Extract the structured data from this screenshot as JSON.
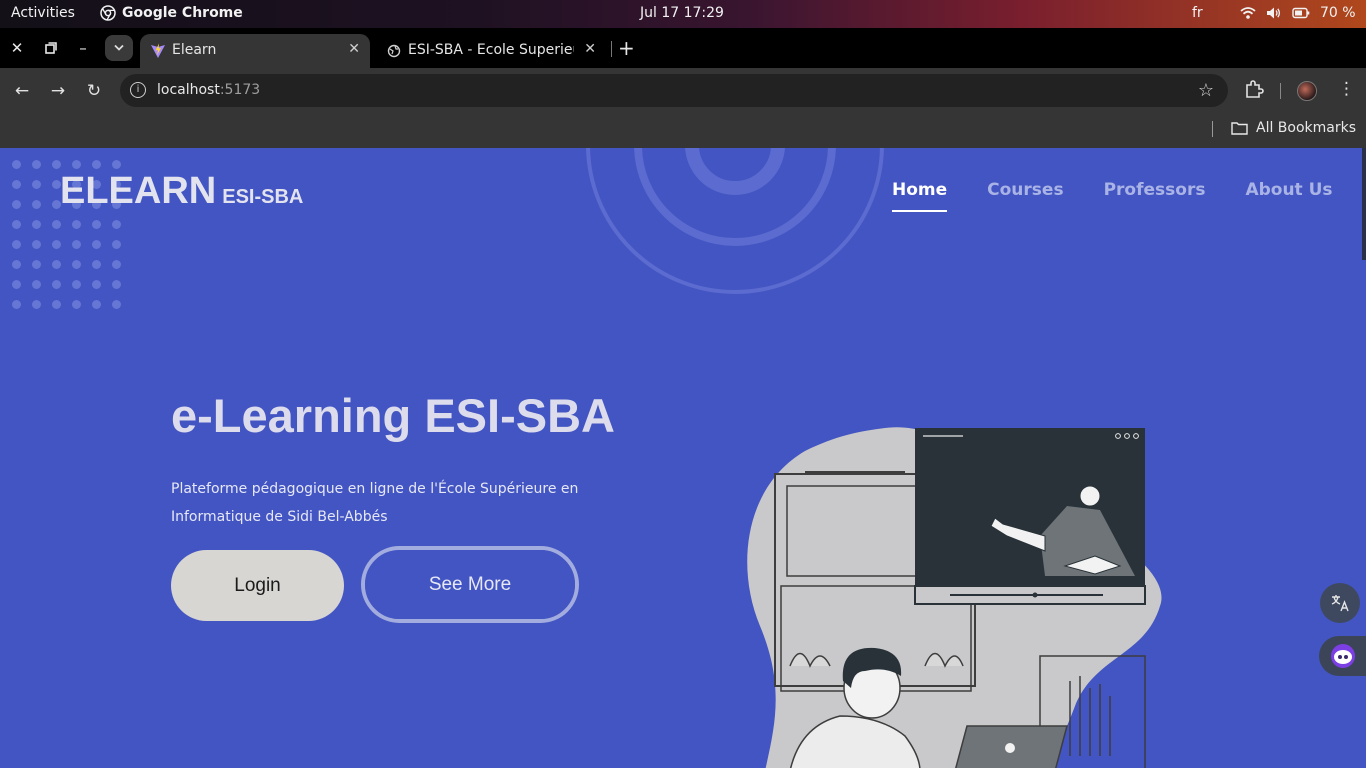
{
  "system_bar": {
    "activities": "Activities",
    "app_name": "Google Chrome",
    "clock": "Jul 17  17:29",
    "language": "fr",
    "battery": "70 %"
  },
  "browser": {
    "tabs": [
      {
        "title": "Elearn",
        "active": true
      },
      {
        "title": "ESI-SBA - Ecole Superieure",
        "active": false
      }
    ],
    "url_host": "localhost",
    "url_port": ":5173",
    "bookmarks_label": "All Bookmarks"
  },
  "site": {
    "logo_main": "ELEARN",
    "logo_sub": "ESI-SBA",
    "nav": [
      {
        "label": "Home",
        "active": true
      },
      {
        "label": "Courses",
        "active": false
      },
      {
        "label": "Professors",
        "active": false
      },
      {
        "label": "About Us",
        "active": false
      }
    ],
    "hero_title": "e-Learning ESI-SBA",
    "hero_description": "Plateforme pédagogique en ligne de l'École Supérieure en Informatique de Sidi Bel-Abbés",
    "login_label": "Login",
    "see_more_label": "See More"
  },
  "colors": {
    "page_background": "#4355c2",
    "login_button": "#d7d6d2",
    "nav_active": "#ffffff",
    "nav_inactive": "#a9b3e6"
  }
}
